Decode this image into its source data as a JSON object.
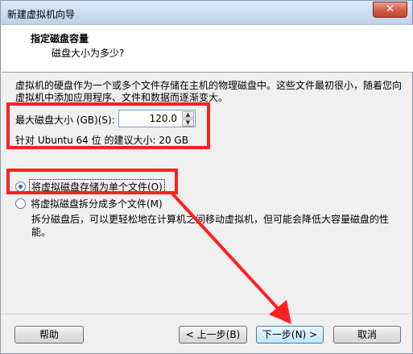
{
  "window": {
    "title": "新建虚拟机向导",
    "close_symbol": "✕"
  },
  "header": {
    "title": "指定磁盘容量",
    "subtitle": "磁盘大小为多少?"
  },
  "description": "虚拟机的硬盘作为一个或多个文件存储在主机的物理磁盘中。这些文件最初很小，随着您向虚拟机中添加应用程序、文件和数据而逐渐变大。",
  "disk": {
    "label": "最大磁盘大小 (GB)(S):",
    "value": "120.0",
    "recommendation": "针对 Ubuntu 64 位 的建议大小: 20 GB"
  },
  "options": {
    "single_file": {
      "label": "将虚拟磁盘存储为单个文件(O)",
      "selected": true
    },
    "multi_file": {
      "label": "将虚拟磁盘拆分成多个文件(M)",
      "selected": false
    },
    "multi_file_desc": "拆分磁盘后，可以更轻松地在计算机之间移动虚拟机，但可能会降低大容量磁盘的性能。"
  },
  "buttons": {
    "help": "帮助",
    "back": "< 上一步(B)",
    "next": "下一步(N) >",
    "cancel": "取消"
  },
  "colors": {
    "annotation": "#ff2020",
    "title_bar": "#c9dbee"
  }
}
